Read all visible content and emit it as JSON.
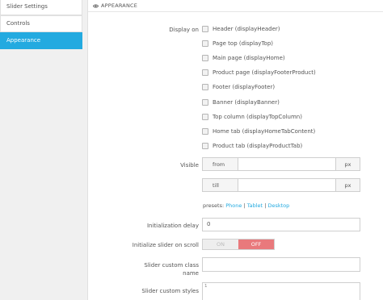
{
  "sidebar": {
    "items": [
      {
        "label": "Slider Settings"
      },
      {
        "label": "Controls"
      },
      {
        "label": "Appearance"
      }
    ]
  },
  "panel": {
    "title": "APPEARANCE"
  },
  "display_on": {
    "label": "Display on",
    "options": [
      {
        "label": "Header (displayHeader)",
        "checked": false
      },
      {
        "label": "Page top (displayTop)",
        "checked": false
      },
      {
        "label": "Main page (displayHome)",
        "checked": false
      },
      {
        "label": "Product page (displayFooterProduct)",
        "checked": false
      },
      {
        "label": "Footer (displayFooter)",
        "checked": false
      },
      {
        "label": "Banner (displayBanner)",
        "checked": false
      },
      {
        "label": "Top column (displayTopColumn)",
        "checked": false
      },
      {
        "label": "Home tab (displayHomeTabContent)",
        "checked": false
      },
      {
        "label": "Product tab (displayProductTab)",
        "checked": false
      }
    ]
  },
  "visible": {
    "label": "Visible",
    "from_label": "from",
    "from_value": "",
    "till_label": "till",
    "till_value": "",
    "unit": "px",
    "presets_label": "presets:",
    "presets": [
      "Phone",
      "Tablet",
      "Desktop"
    ],
    "separator": "|"
  },
  "init_delay": {
    "label": "Initialization delay",
    "value": "0"
  },
  "init_on_scroll": {
    "label": "Initialize slider on scroll",
    "on_label": "ON",
    "off_label": "OFF",
    "state": "off"
  },
  "custom_class": {
    "label_line1": "Slider custom class",
    "label_line2": "name",
    "value": ""
  },
  "custom_styles": {
    "label": "Slider custom styles",
    "line_number": "1"
  }
}
